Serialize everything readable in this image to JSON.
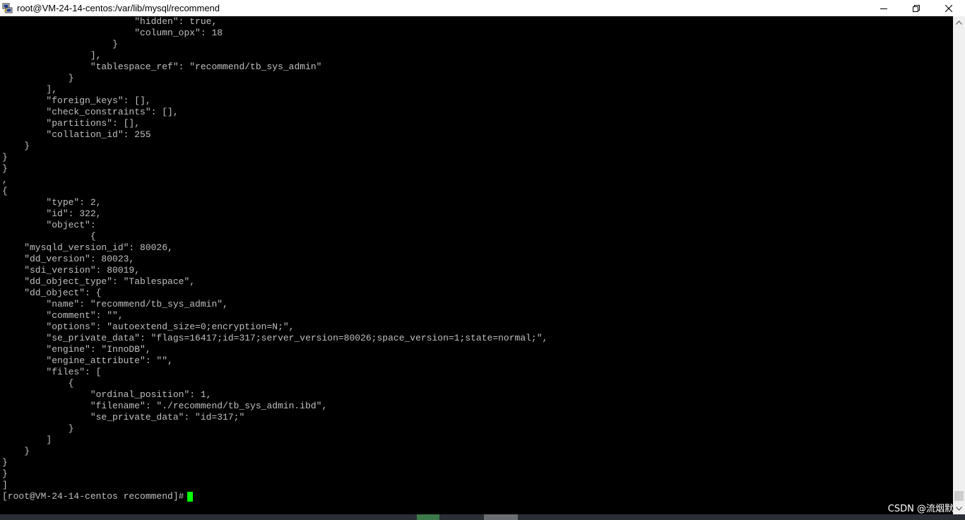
{
  "window": {
    "title": "root@VM-24-14-centos:/var/lib/mysql/recommend",
    "app_icon": "putty-icon",
    "controls": {
      "minimize": "minimize-icon",
      "maximize": "restore-icon",
      "close": "close-icon"
    }
  },
  "terminal": {
    "lines": [
      "                        \"hidden\": true,",
      "                        \"column_opx\": 18",
      "                    }",
      "                ],",
      "                \"tablespace_ref\": \"recommend/tb_sys_admin\"",
      "            }",
      "        ],",
      "        \"foreign_keys\": [],",
      "        \"check_constraints\": [],",
      "        \"partitions\": [],",
      "        \"collation_id\": 255",
      "    }",
      "}",
      "}",
      ",",
      "{",
      "        \"type\": 2,",
      "        \"id\": 322,",
      "        \"object\":",
      "                {",
      "    \"mysqld_version_id\": 80026,",
      "    \"dd_version\": 80023,",
      "    \"sdi_version\": 80019,",
      "    \"dd_object_type\": \"Tablespace\",",
      "    \"dd_object\": {",
      "        \"name\": \"recommend/tb_sys_admin\",",
      "        \"comment\": \"\",",
      "        \"options\": \"autoextend_size=0;encryption=N;\",",
      "        \"se_private_data\": \"flags=16417;id=317;server_version=80026;space_version=1;state=normal;\",",
      "        \"engine\": \"InnoDB\",",
      "        \"engine_attribute\": \"\",",
      "        \"files\": [",
      "            {",
      "                \"ordinal_position\": 1,",
      "                \"filename\": \"./recommend/tb_sys_admin.ibd\",",
      "                \"se_private_data\": \"id=317;\"",
      "            }",
      "        ]",
      "    }",
      "}",
      "}",
      "]"
    ],
    "prompt": "[root@VM-24-14-centos recommend]#",
    "text_color": "#c0c0c0",
    "cursor_color": "#00ff00",
    "background": "#000000"
  },
  "watermark": "CSDN @流烟默"
}
